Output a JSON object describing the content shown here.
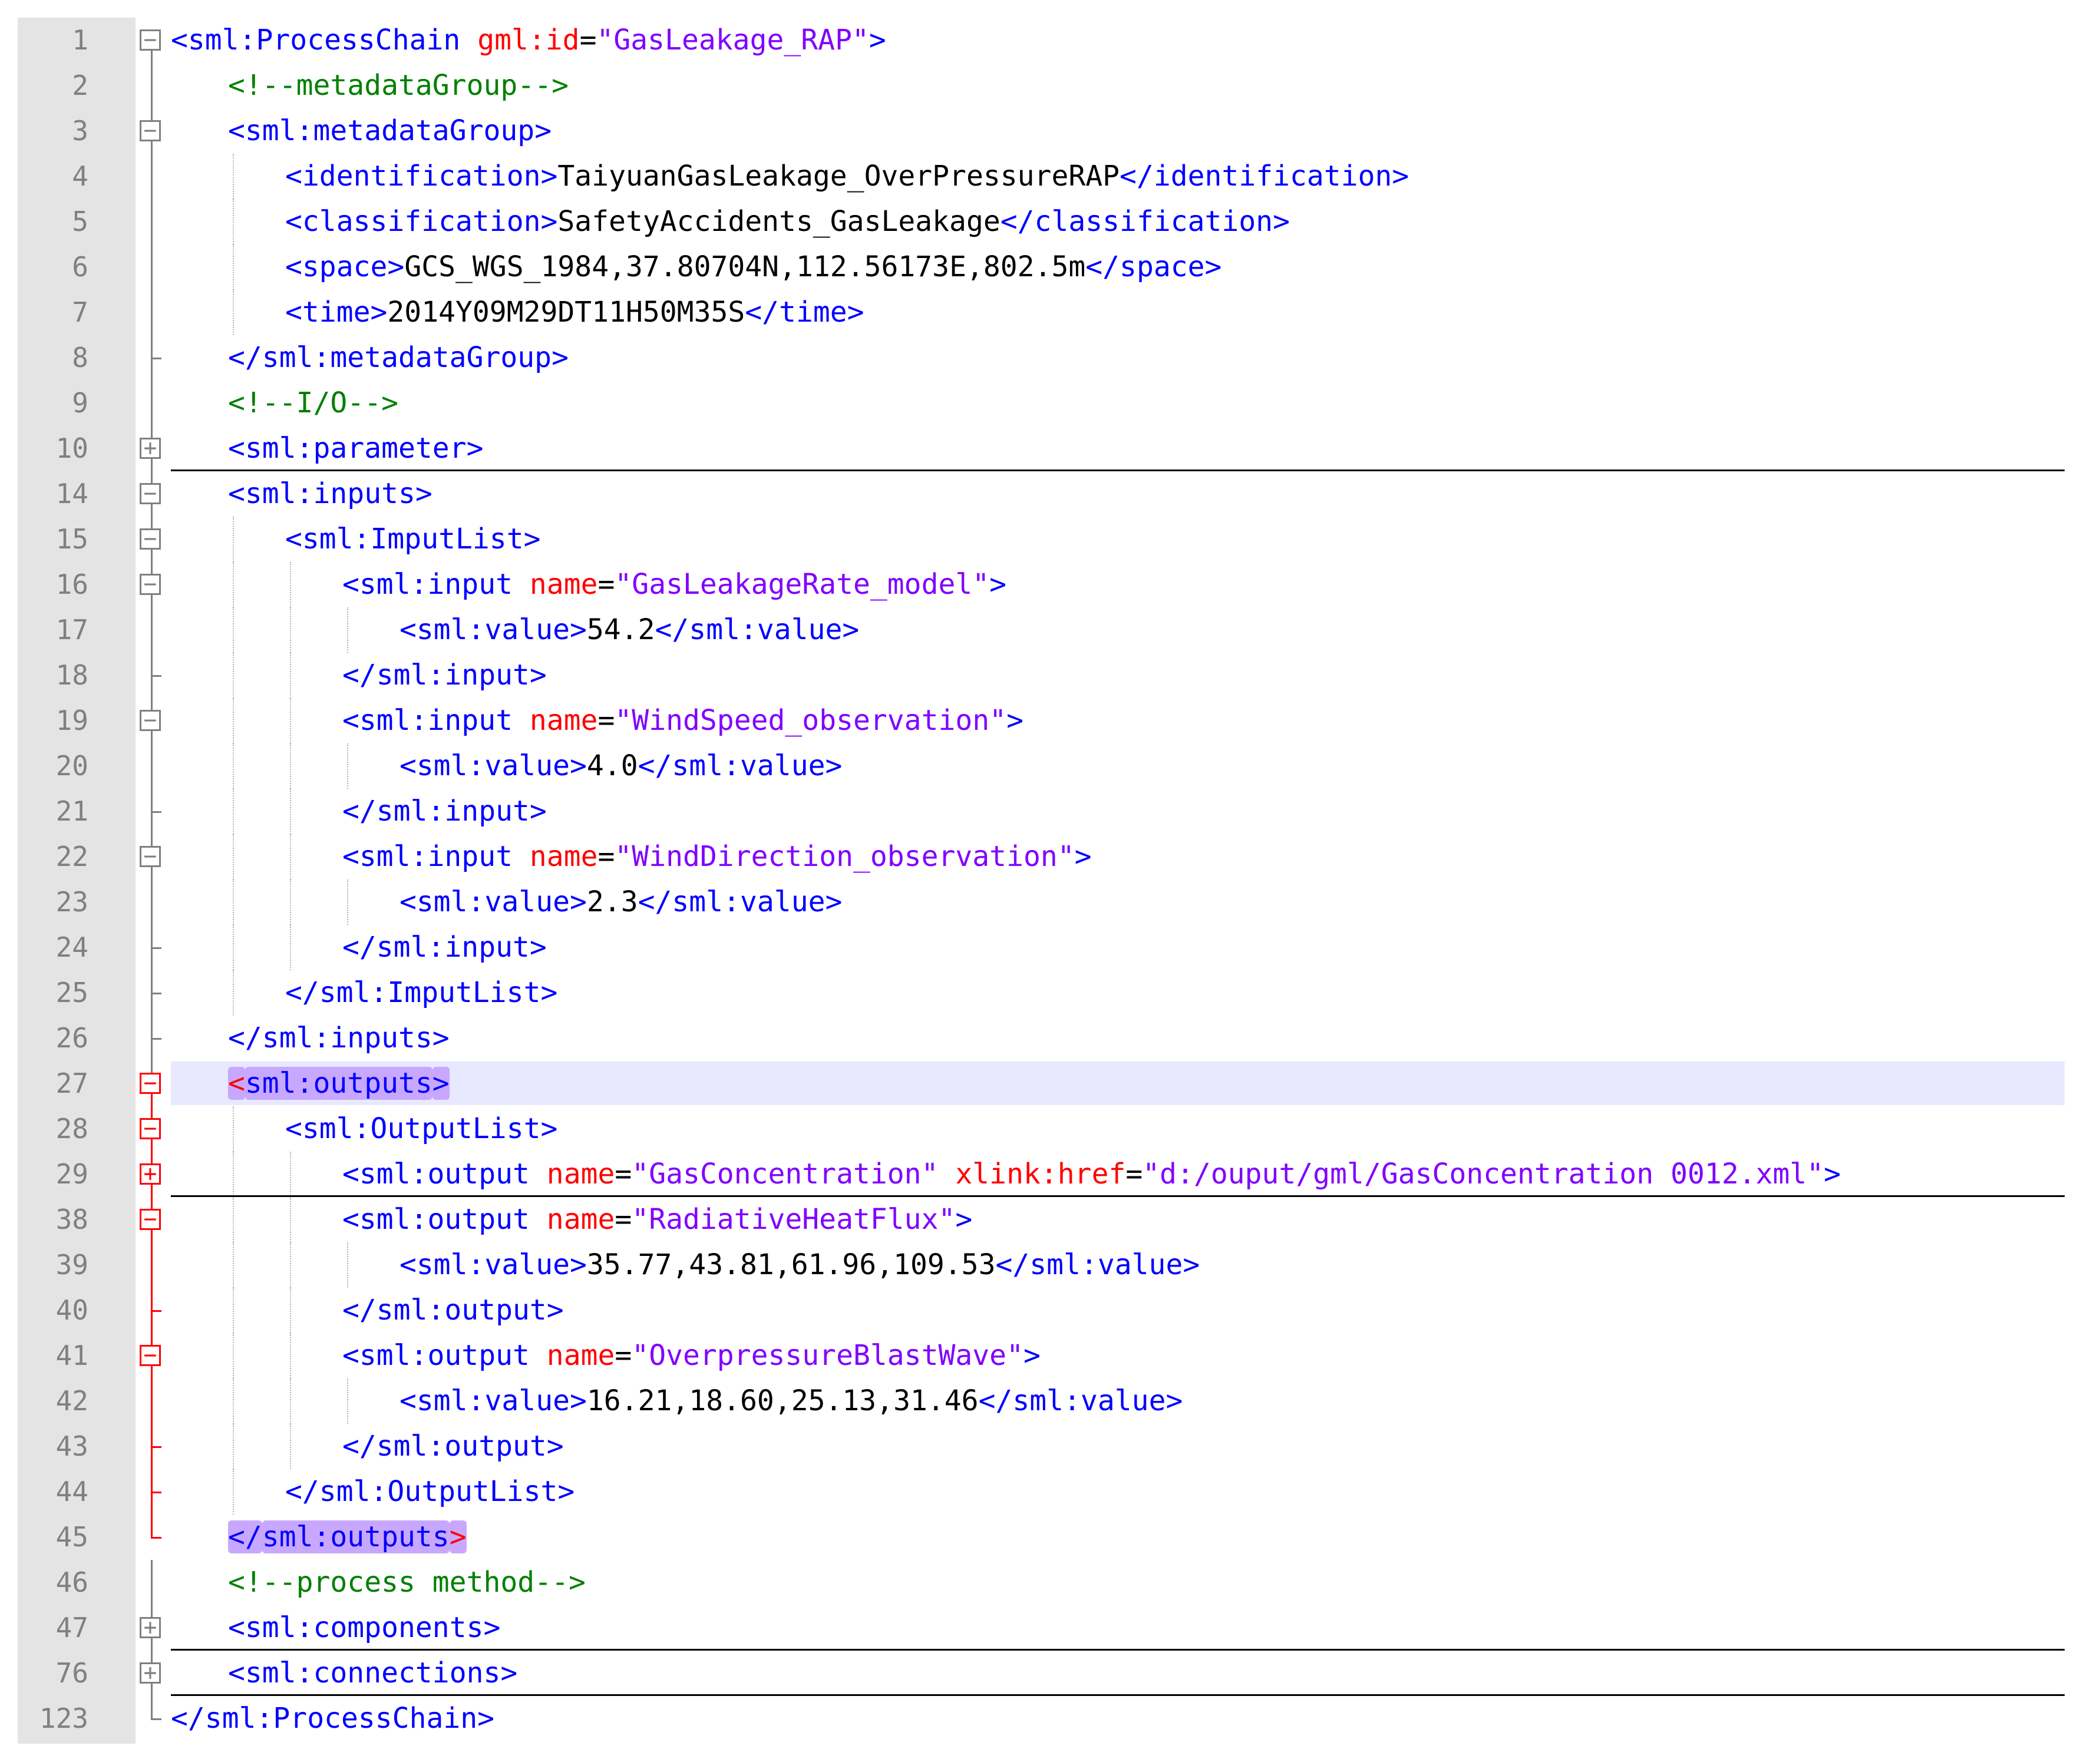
{
  "colors": {
    "tag": "#0000ff",
    "attribute": "#ff0000",
    "value": "#8000ff",
    "text": "#000000",
    "comment": "#008000",
    "line_number": "#808080",
    "current_line": "#e8e8ff",
    "match_highlight": "#c8a8ff"
  },
  "lines": [
    {
      "num": "1",
      "fold": "minus",
      "indent": 0,
      "tokens": [
        [
          "tag",
          "<"
        ],
        [
          "name",
          "sml:ProcessChain"
        ],
        [
          "sp",
          " "
        ],
        [
          "attr",
          "gml:id"
        ],
        [
          "eq",
          "="
        ],
        [
          "val",
          "\"GasLeakage_RAP\""
        ],
        [
          "tag",
          ">"
        ]
      ]
    },
    {
      "num": "2",
      "fold": "line",
      "indent": 1,
      "tokens": [
        [
          "cmt",
          "<!--metadataGroup-->"
        ]
      ]
    },
    {
      "num": "3",
      "fold": "minus",
      "indent": 1,
      "tokens": [
        [
          "tag",
          "<"
        ],
        [
          "name",
          "sml:metadataGroup"
        ],
        [
          "tag",
          ">"
        ]
      ]
    },
    {
      "num": "4",
      "fold": "line",
      "indent": 2,
      "tokens": [
        [
          "tag",
          "<"
        ],
        [
          "name",
          "identification"
        ],
        [
          "tag",
          ">"
        ],
        [
          "text",
          "TaiyuanGasLeakage_OverPressureRAP"
        ],
        [
          "tag",
          "</"
        ],
        [
          "name",
          "identification"
        ],
        [
          "tag",
          ">"
        ]
      ]
    },
    {
      "num": "5",
      "fold": "line",
      "indent": 2,
      "tokens": [
        [
          "tag",
          "<"
        ],
        [
          "name",
          "classification"
        ],
        [
          "tag",
          ">"
        ],
        [
          "text",
          "SafetyAccidents_GasLeakage"
        ],
        [
          "tag",
          "</"
        ],
        [
          "name",
          "classification"
        ],
        [
          "tag",
          ">"
        ]
      ]
    },
    {
      "num": "6",
      "fold": "line",
      "indent": 2,
      "tokens": [
        [
          "tag",
          "<"
        ],
        [
          "name",
          "space"
        ],
        [
          "tag",
          ">"
        ],
        [
          "text",
          "GCS_WGS_1984,37.80704N,112.56173E,802.5m"
        ],
        [
          "tag",
          "</"
        ],
        [
          "name",
          "space"
        ],
        [
          "tag",
          ">"
        ]
      ]
    },
    {
      "num": "7",
      "fold": "line",
      "indent": 2,
      "tokens": [
        [
          "tag",
          "<"
        ],
        [
          "name",
          "time"
        ],
        [
          "tag",
          ">"
        ],
        [
          "text",
          "2014Y09M29DT11H50M35S"
        ],
        [
          "tag",
          "</"
        ],
        [
          "name",
          "time"
        ],
        [
          "tag",
          ">"
        ]
      ]
    },
    {
      "num": "8",
      "fold": "end",
      "indent": 1,
      "tokens": [
        [
          "tag",
          "</"
        ],
        [
          "name",
          "sml:metadataGroup"
        ],
        [
          "tag",
          ">"
        ]
      ]
    },
    {
      "num": "9",
      "fold": "line",
      "indent": 1,
      "tokens": [
        [
          "cmt",
          "<!--I/O-->"
        ]
      ]
    },
    {
      "num": "10",
      "fold": "plus",
      "indent": 1,
      "sep": true,
      "tokens": [
        [
          "tag",
          "<"
        ],
        [
          "name",
          "sml:parameter"
        ],
        [
          "tag",
          ">"
        ]
      ]
    },
    {
      "num": "14",
      "fold": "minus",
      "indent": 1,
      "tokens": [
        [
          "tag",
          "<"
        ],
        [
          "name",
          "sml:inputs"
        ],
        [
          "tag",
          ">"
        ]
      ]
    },
    {
      "num": "15",
      "fold": "minus",
      "indent": 2,
      "tokens": [
        [
          "tag",
          "<"
        ],
        [
          "name",
          "sml:ImputList"
        ],
        [
          "tag",
          ">"
        ]
      ]
    },
    {
      "num": "16",
      "fold": "minus",
      "indent": 3,
      "tokens": [
        [
          "tag",
          "<"
        ],
        [
          "name",
          "sml:input"
        ],
        [
          "sp",
          " "
        ],
        [
          "attr",
          "name"
        ],
        [
          "eq",
          "="
        ],
        [
          "val",
          "\"GasLeakageRate_model\""
        ],
        [
          "tag",
          ">"
        ]
      ]
    },
    {
      "num": "17",
      "fold": "line",
      "indent": 4,
      "tokens": [
        [
          "tag",
          "<"
        ],
        [
          "name",
          "sml:value"
        ],
        [
          "tag",
          ">"
        ],
        [
          "text",
          "54.2"
        ],
        [
          "tag",
          "</"
        ],
        [
          "name",
          "sml:value"
        ],
        [
          "tag",
          ">"
        ]
      ]
    },
    {
      "num": "18",
      "fold": "end",
      "indent": 3,
      "tokens": [
        [
          "tag",
          "</"
        ],
        [
          "name",
          "sml:input"
        ],
        [
          "tag",
          ">"
        ]
      ]
    },
    {
      "num": "19",
      "fold": "minus",
      "indent": 3,
      "tokens": [
        [
          "tag",
          "<"
        ],
        [
          "name",
          "sml:input"
        ],
        [
          "sp",
          " "
        ],
        [
          "attr",
          "name"
        ],
        [
          "eq",
          "="
        ],
        [
          "val",
          "\"WindSpeed_observation\""
        ],
        [
          "tag",
          ">"
        ]
      ]
    },
    {
      "num": "20",
      "fold": "line",
      "indent": 4,
      "tokens": [
        [
          "tag",
          "<"
        ],
        [
          "name",
          "sml:value"
        ],
        [
          "tag",
          ">"
        ],
        [
          "text",
          "4.0"
        ],
        [
          "tag",
          "</"
        ],
        [
          "name",
          "sml:value"
        ],
        [
          "tag",
          ">"
        ]
      ]
    },
    {
      "num": "21",
      "fold": "end",
      "indent": 3,
      "tokens": [
        [
          "tag",
          "</"
        ],
        [
          "name",
          "sml:input"
        ],
        [
          "tag",
          ">"
        ]
      ]
    },
    {
      "num": "22",
      "fold": "minus",
      "indent": 3,
      "tokens": [
        [
          "tag",
          "<"
        ],
        [
          "name",
          "sml:input"
        ],
        [
          "sp",
          " "
        ],
        [
          "attr",
          "name"
        ],
        [
          "eq",
          "="
        ],
        [
          "val",
          "\"WindDirection_observation\""
        ],
        [
          "tag",
          ">"
        ]
      ]
    },
    {
      "num": "23",
      "fold": "line",
      "indent": 4,
      "tokens": [
        [
          "tag",
          "<"
        ],
        [
          "name",
          "sml:value"
        ],
        [
          "tag",
          ">"
        ],
        [
          "text",
          "2.3"
        ],
        [
          "tag",
          "</"
        ],
        [
          "name",
          "sml:value"
        ],
        [
          "tag",
          ">"
        ]
      ]
    },
    {
      "num": "24",
      "fold": "end",
      "indent": 3,
      "tokens": [
        [
          "tag",
          "</"
        ],
        [
          "name",
          "sml:input"
        ],
        [
          "tag",
          ">"
        ]
      ]
    },
    {
      "num": "25",
      "fold": "end",
      "indent": 2,
      "tokens": [
        [
          "tag",
          "</"
        ],
        [
          "name",
          "sml:ImputList"
        ],
        [
          "tag",
          ">"
        ]
      ]
    },
    {
      "num": "26",
      "fold": "end",
      "indent": 1,
      "tokens": [
        [
          "tag",
          "</"
        ],
        [
          "name",
          "sml:inputs"
        ],
        [
          "tag",
          ">"
        ]
      ]
    },
    {
      "num": "27",
      "fold": "minus",
      "red": true,
      "current": true,
      "indent": 1,
      "tokens": [
        [
          "hlopen",
          "<"
        ],
        [
          "hlname",
          "sml:outputs"
        ],
        [
          "hltag",
          ">"
        ]
      ]
    },
    {
      "num": "28",
      "fold": "minus",
      "red": true,
      "indent": 2,
      "tokens": [
        [
          "tag",
          "<"
        ],
        [
          "name",
          "sml:OutputList"
        ],
        [
          "tag",
          ">"
        ]
      ]
    },
    {
      "num": "29",
      "fold": "plus",
      "red": true,
      "indent": 3,
      "sep": true,
      "tokens": [
        [
          "tag",
          "<"
        ],
        [
          "name",
          "sml:output"
        ],
        [
          "sp",
          " "
        ],
        [
          "attr",
          "name"
        ],
        [
          "eq",
          "="
        ],
        [
          "val",
          "\"GasConcentration\""
        ],
        [
          "sp",
          " "
        ],
        [
          "attr",
          "xlink:href"
        ],
        [
          "eq",
          "="
        ],
        [
          "val",
          "\"d:/ouput/gml/GasConcentration 0012.xml\""
        ],
        [
          "tag",
          ">"
        ]
      ]
    },
    {
      "num": "38",
      "fold": "minus",
      "red": true,
      "indent": 3,
      "tokens": [
        [
          "tag",
          "<"
        ],
        [
          "name",
          "sml:output"
        ],
        [
          "sp",
          " "
        ],
        [
          "attr",
          "name"
        ],
        [
          "eq",
          "="
        ],
        [
          "val",
          "\"RadiativeHeatFlux\""
        ],
        [
          "tag",
          ">"
        ]
      ]
    },
    {
      "num": "39",
      "fold": "line",
      "red": true,
      "indent": 4,
      "tokens": [
        [
          "tag",
          "<"
        ],
        [
          "name",
          "sml:value"
        ],
        [
          "tag",
          ">"
        ],
        [
          "text",
          "35.77,43.81,61.96,109.53"
        ],
        [
          "tag",
          "</"
        ],
        [
          "name",
          "sml:value"
        ],
        [
          "tag",
          ">"
        ]
      ]
    },
    {
      "num": "40",
      "fold": "end",
      "red": true,
      "indent": 3,
      "tokens": [
        [
          "tag",
          "</"
        ],
        [
          "name",
          "sml:output"
        ],
        [
          "tag",
          ">"
        ]
      ]
    },
    {
      "num": "41",
      "fold": "minus",
      "red": true,
      "indent": 3,
      "tokens": [
        [
          "tag",
          "<"
        ],
        [
          "name",
          "sml:output"
        ],
        [
          "sp",
          " "
        ],
        [
          "attr",
          "name"
        ],
        [
          "eq",
          "="
        ],
        [
          "val",
          "\"OverpressureBlastWave\""
        ],
        [
          "tag",
          ">"
        ]
      ]
    },
    {
      "num": "42",
      "fold": "line",
      "red": true,
      "indent": 4,
      "tokens": [
        [
          "tag",
          "<"
        ],
        [
          "name",
          "sml:value"
        ],
        [
          "tag",
          ">"
        ],
        [
          "text",
          "16.21,18.60,25.13,31.46"
        ],
        [
          "tag",
          "</"
        ],
        [
          "name",
          "sml:value"
        ],
        [
          "tag",
          ">"
        ]
      ]
    },
    {
      "num": "43",
      "fold": "end",
      "red": true,
      "indent": 3,
      "tokens": [
        [
          "tag",
          "</"
        ],
        [
          "name",
          "sml:output"
        ],
        [
          "tag",
          ">"
        ]
      ]
    },
    {
      "num": "44",
      "fold": "end",
      "red": true,
      "indent": 2,
      "tokens": [
        [
          "tag",
          "</"
        ],
        [
          "name",
          "sml:OutputList"
        ],
        [
          "tag",
          ">"
        ]
      ]
    },
    {
      "num": "45",
      "fold": "endred",
      "red": true,
      "indent": 1,
      "tokens": [
        [
          "hltag",
          "</"
        ],
        [
          "hlname",
          "sml:outputs"
        ],
        [
          "hlclose",
          ">"
        ]
      ]
    },
    {
      "num": "46",
      "fold": "line",
      "indent": 1,
      "tokens": [
        [
          "cmt",
          "<!--process method-->"
        ]
      ]
    },
    {
      "num": "47",
      "fold": "plus",
      "indent": 1,
      "sep": true,
      "tokens": [
        [
          "tag",
          "<"
        ],
        [
          "name",
          "sml:components"
        ],
        [
          "tag",
          ">"
        ]
      ]
    },
    {
      "num": "76",
      "fold": "plus",
      "indent": 1,
      "sep": true,
      "tokens": [
        [
          "tag",
          "<"
        ],
        [
          "name",
          "sml:connections"
        ],
        [
          "tag",
          ">"
        ]
      ]
    },
    {
      "num": "123",
      "fold": "last",
      "indent": 0,
      "tokens": [
        [
          "tag",
          "</"
        ],
        [
          "name",
          "sml:ProcessChain"
        ],
        [
          "tag",
          ">"
        ]
      ]
    }
  ]
}
